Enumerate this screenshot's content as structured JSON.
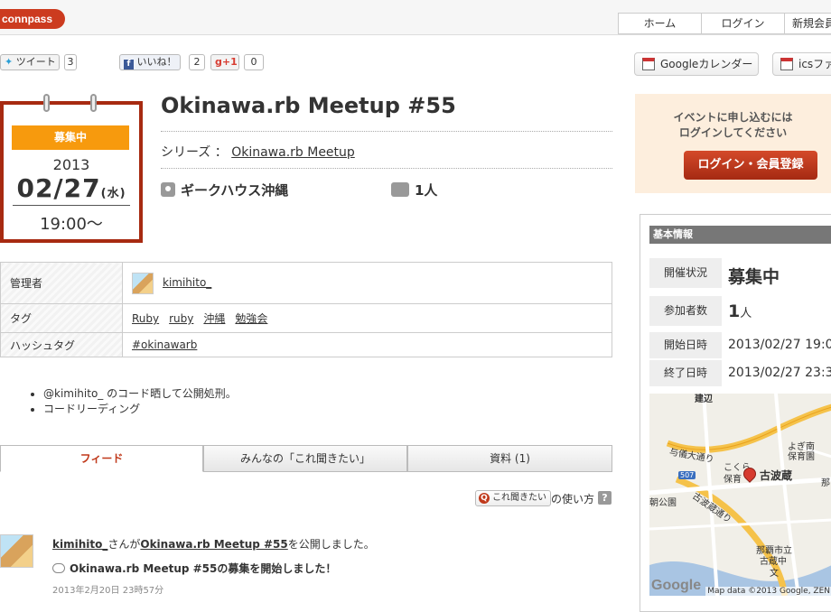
{
  "header": {
    "logo": "connpass",
    "nav": [
      "ホーム",
      "ログイン",
      "新規会員"
    ]
  },
  "social": {
    "tweet_label": "ツイート",
    "tweet_count": "3",
    "like_label": "いいね！",
    "like_count": "2",
    "gplus_label": "+1",
    "gplus_count": "0"
  },
  "calendar": {
    "google": "Googleカレンダー",
    "ics": "icsファ"
  },
  "event": {
    "status": "募集中",
    "year": "2013",
    "date": "02/27",
    "dow": "(水)",
    "time": "19:00〜",
    "title": "Okinawa.rb Meetup #55",
    "series_label": "シリーズ ：",
    "series_link": "Okinawa.rb Meetup",
    "place": "ギークハウス沖縄",
    "participants": "1人"
  },
  "info": {
    "admin_label": "管理者",
    "admin_name": "kimihito_",
    "tag_label": "タグ",
    "tags": [
      "Ruby",
      "ruby",
      "沖縄",
      "勉強会"
    ],
    "hashtag_label": "ハッシュタグ",
    "hashtag": "#okinawarb"
  },
  "description": [
    "@kimihito_ のコード晒して公開処刑。",
    "コードリーディング"
  ],
  "tabs": [
    "フィード",
    "みんなの「これ聞きたい」",
    "資料 (1)"
  ],
  "question": {
    "button": "これ聞きたい",
    "usage": "の使い方",
    "help": "?"
  },
  "feed": {
    "user": "kimihito_",
    "mid": "さんが",
    "event_link": "Okinawa.rb Meetup #55",
    "tail": "を公開しました。",
    "message": "Okinawa.rb Meetup #55の募集を開始しました！",
    "time": "2013年2月20日 23時57分"
  },
  "sidebar": {
    "notice_line1": "イベントに申し込むには",
    "notice_line2": "ログインしてください",
    "login_button": "ログイン・会員登録",
    "basic_header": "基本情報",
    "status_label": "開催状況",
    "status_value": "募集中",
    "count_label": "参加者数",
    "count_value": "1",
    "count_unit": "人",
    "start_label": "開始日時",
    "start_value": "2013/02/27 19:0",
    "end_label": "終了日時",
    "end_value": "2013/02/27 23:3"
  },
  "map": {
    "labels": [
      "建辺",
      "与儀大通り",
      "よぎ南",
      "保育園",
      "こくら",
      "保育",
      "古波蔵",
      "507",
      "朝公園",
      "古波蔵通り",
      "那覇市立",
      "古蔵中",
      "文",
      "那"
    ],
    "place_label": "古波蔵",
    "google": "Google",
    "attribution": "Map data ©2013 Google, ZEN"
  },
  "colors": {
    "brand": "#cc3b1f",
    "status": "#f79a0d",
    "datebox_border": "#a72a11"
  }
}
